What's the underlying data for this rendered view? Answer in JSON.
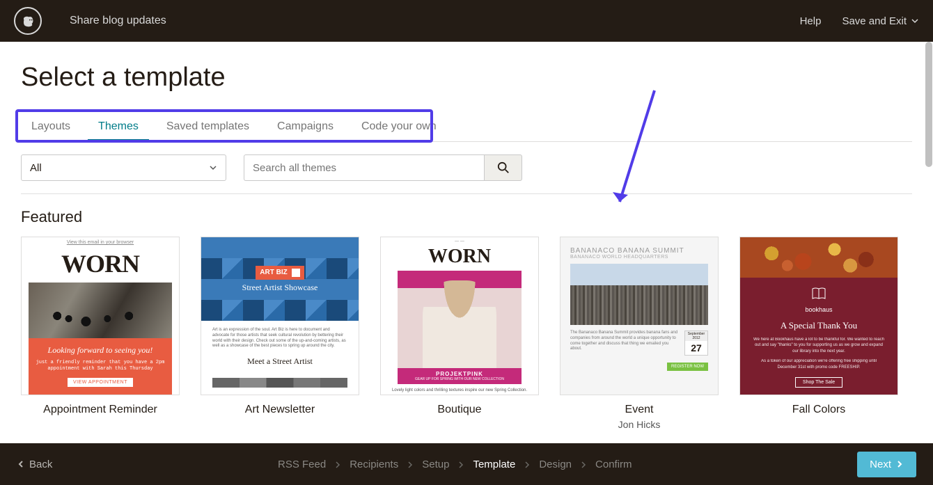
{
  "topbar": {
    "title": "Share blog updates",
    "help": "Help",
    "save_exit": "Save and Exit"
  },
  "page": {
    "title": "Select a template"
  },
  "tabs": [
    {
      "label": "Layouts",
      "active": false
    },
    {
      "label": "Themes",
      "active": true
    },
    {
      "label": "Saved templates",
      "active": false
    },
    {
      "label": "Campaigns",
      "active": false
    },
    {
      "label": "Code your own",
      "active": false
    }
  ],
  "filter": {
    "dropdown_value": "All",
    "search_placeholder": "Search all themes"
  },
  "section": {
    "title": "Featured"
  },
  "templates": [
    {
      "name": "Appointment Reminder",
      "author": "",
      "preview": {
        "view_link": "View this email in your browser",
        "brand": "WORN",
        "headline": "Looking forward to seeing you!",
        "body": "just a friendly reminder that you have a 2pm appointment with Sarah this Thursday",
        "button": "VIEW APPOINTMENT"
      }
    },
    {
      "name": "Art Newsletter",
      "author": "",
      "preview": {
        "badge": "ART BIZ",
        "headline": "Street Artist Showcase",
        "body": "Art is an expression of the soul. Art Biz is here to document and advocate for those artists that seek cultural revolution by bettering their world with their design. Check out some of the up-and-coming artists, as well as a showcase of the best pieces to spring up around the city.",
        "subhead": "Meet a Street Artist"
      }
    },
    {
      "name": "Boutique",
      "author": "",
      "preview": {
        "brand": "WORN",
        "tag": "PROJEKTPINK",
        "subtag": "GEAR UP FOR SPRING WITH OUR NEW COLLECTION",
        "footer": "Lovely light colors and thrilling textures inspire our new Spring Collection."
      }
    },
    {
      "name": "Event",
      "author": "Jon Hicks",
      "preview": {
        "title": "BANANACO BANANA SUMMIT",
        "subtitle": "BANANACO WORLD HEADQUARTERS",
        "body": "The Bananaco Banana Summit provides banana fans and companies from around the world a unique opportunity to come together and discuss that thing we emailed you about.",
        "month": "September 2012",
        "day": "27",
        "button": "REGISTER NOW"
      }
    },
    {
      "name": "Fall Colors",
      "author": "",
      "preview": {
        "brand": "bookhaus",
        "headline": "A Special Thank You",
        "p1": "We here at Bookhaus have a lot to be thankful for. We wanted to reach out and say \"thanks\" to you for supporting us as we grow and expand our library into the next year.",
        "p2": "As a token of our appreciation we're offering free shipping until December 31st with promo code FREESHIP.",
        "button": "Shop The Sale"
      }
    }
  ],
  "footer": {
    "back": "Back",
    "next": "Next",
    "crumbs": [
      {
        "label": "RSS Feed",
        "active": false
      },
      {
        "label": "Recipients",
        "active": false
      },
      {
        "label": "Setup",
        "active": false
      },
      {
        "label": "Template",
        "active": true
      },
      {
        "label": "Design",
        "active": false
      },
      {
        "label": "Confirm",
        "active": false
      }
    ]
  }
}
